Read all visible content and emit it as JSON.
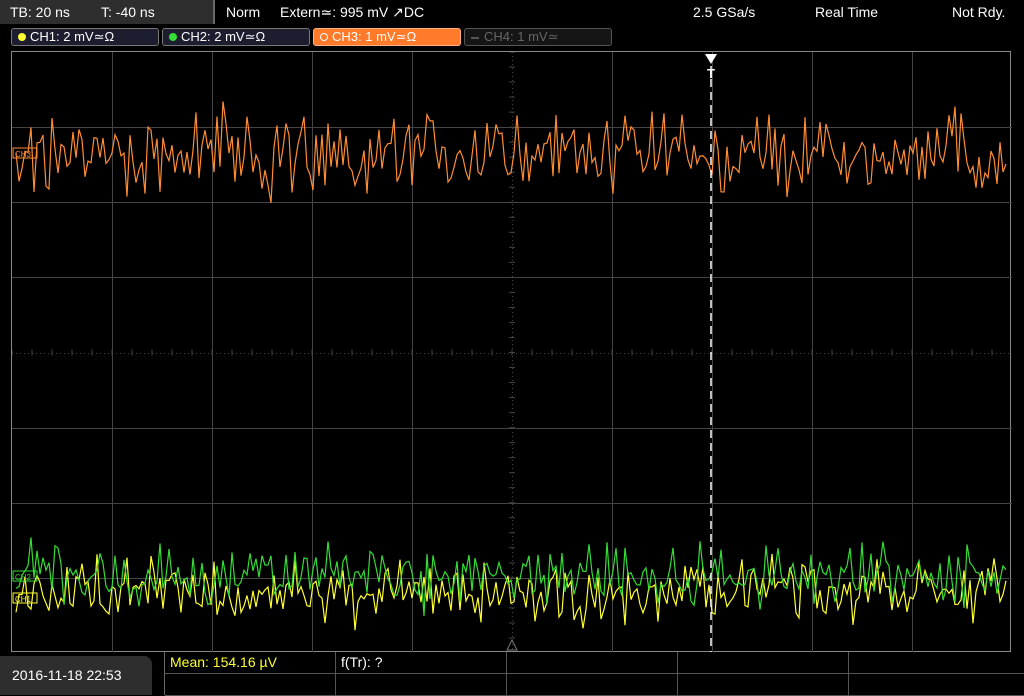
{
  "topbar": {
    "timebase": "TB: 20 ns",
    "trigger_offset": "T: -40 ns",
    "trigger_mode": "Norm",
    "trigger_source": "Extern≃: 995 mV ↗DC",
    "sample_rate": "2.5 GSa/s",
    "acq_mode": "Real Time",
    "status": "Not Rdy."
  },
  "channels": [
    {
      "label": "CH1: 2 mV≃Ω",
      "color": "#ffff33",
      "active": true
    },
    {
      "label": "CH2: 2 mV≃Ω",
      "color": "#33dd33",
      "active": true
    },
    {
      "label": "CH3: 1 mV≃Ω",
      "color": "#ff8c33",
      "active": true,
      "selected": true
    },
    {
      "label": "CH4: 1 mV≃",
      "color": "#555555",
      "active": false
    }
  ],
  "trigger_marker": "T",
  "markers": {
    "ch3": "CH3",
    "ch2": "CH2",
    "ch1": "CH1"
  },
  "colors": {
    "ch1": "#ffff33",
    "ch2": "#33dd33",
    "ch3": "#ff8c33",
    "grid": "#444444"
  },
  "footer": {
    "datetime": "2016-11-18 22:53",
    "measurement_1": "Mean: 154.16 µV",
    "measurement_2": "f(Tr): ?"
  }
}
